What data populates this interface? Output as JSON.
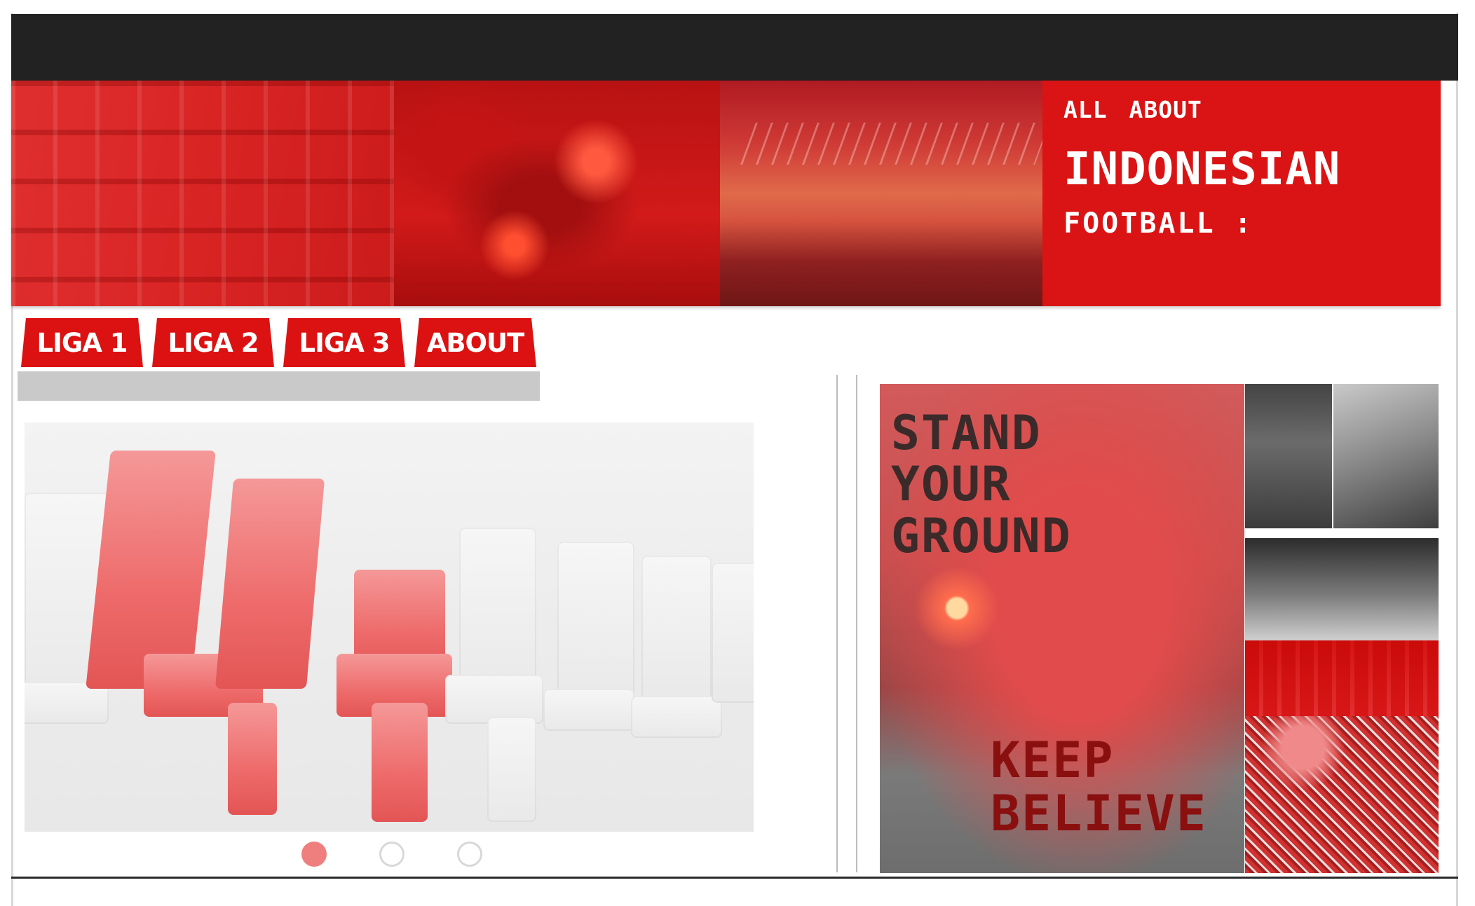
{
  "header": {
    "line1": "ALL  ABOUT",
    "line2": "INDONESIAN",
    "line3": "FOOTBALL :"
  },
  "nav": {
    "tabs": [
      {
        "label": "LIGA 1"
      },
      {
        "label": "LIGA 2"
      },
      {
        "label": "LIGA 3"
      },
      {
        "label": "ABOUT"
      }
    ]
  },
  "slider": {
    "total_slides": 3,
    "active_index": 0
  },
  "poster": {
    "headline": "STAND\nYOUR\nGROUND",
    "tagline": "KEEP\nBELIEVE"
  },
  "colors": {
    "brand_red": "#da1414",
    "top_bar": "#222222",
    "tab_underline": "#c9c9c9"
  }
}
